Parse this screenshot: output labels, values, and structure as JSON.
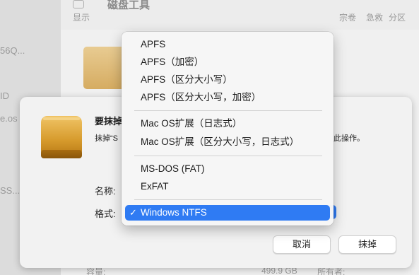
{
  "background": {
    "window_title": "磁盘工具",
    "toolbar": {
      "view_label": "显示",
      "volume_label": "宗卷",
      "rescue_label": "急救",
      "partition_label": "分区"
    },
    "sidebar_fragments": [
      "56Q...",
      "ID",
      "e.os",
      "SS..."
    ],
    "bottom_left": "容量:",
    "bottom_value": "499.9 GB",
    "bottom_right": "所有者:"
  },
  "dialog": {
    "title": "要抹掉",
    "message": "抹掉“S",
    "message_tail": "此操作。",
    "name_label": "名称:",
    "format_label": "格式:",
    "cancel_label": "取消",
    "erase_label": "抹掉"
  },
  "format_menu": {
    "items": [
      "APFS",
      "APFS（加密）",
      "APFS（区分大小写）",
      "APFS（区分大小写，加密）",
      "Mac OS扩展（日志式）",
      "Mac OS扩展（区分大小写，日志式）",
      "MS-DOS (FAT)",
      "ExFAT",
      "Windows NTFS"
    ],
    "selected": "Windows NTFS",
    "check_glyph": "✓"
  },
  "colors": {
    "accent": "#2f7bf3",
    "drive_gold": "#d9a441"
  }
}
